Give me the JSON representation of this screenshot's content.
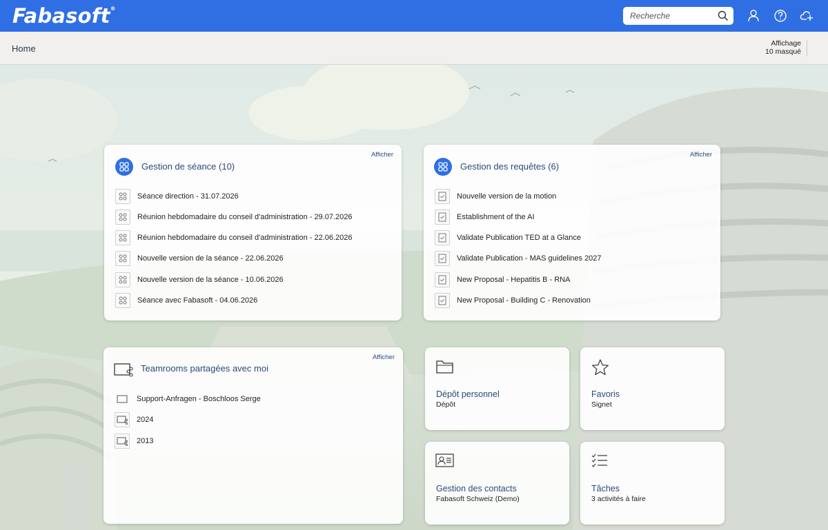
{
  "header": {
    "logo_text": "Fabasoft",
    "logo_reg": "®",
    "search_placeholder": "Recherche"
  },
  "navbar": {
    "breadcrumb": "Home",
    "display_label": "Affichage",
    "hidden_count": "10 masqué"
  },
  "meetings": {
    "title": "Gestion de séance (10)",
    "action": "Afficher",
    "items": [
      {
        "label": "Séance direction - 31.07.2026"
      },
      {
        "label": "Réunion hebdomadaire du conseil d'administration - 29.07.2026"
      },
      {
        "label": "Réunion hebdomadaire du conseil d'administration - 22.06.2026"
      },
      {
        "label": "Nouvelle version de la séance - 22.06.2026"
      },
      {
        "label": "Nouvelle version de la séance - 10.06.2026"
      },
      {
        "label": "Séance avec Fabasoft - 04.06.2026"
      }
    ]
  },
  "requests": {
    "title": "Gestion des requêtes (6)",
    "action": "Afficher",
    "items": [
      {
        "label": "Nouvelle version de la motion"
      },
      {
        "label": "Establishment of the AI"
      },
      {
        "label": "Validate Publication TED at a Glance"
      },
      {
        "label": "Validate Publication - MAS guidelines 2027"
      },
      {
        "label": "New Proposal - Hepatitis B - RNA"
      },
      {
        "label": "New Proposal - Building C - Renovation"
      }
    ]
  },
  "teamrooms": {
    "title": "Teamrooms partagées avec moi",
    "action": "Afficher",
    "items": [
      {
        "label": "Support-Anfragen - Boschloos Serge"
      },
      {
        "label": "2024"
      },
      {
        "label": "2013"
      }
    ]
  },
  "tiles": {
    "personal": {
      "title": "Dépôt personnel",
      "sub": "Dépôt",
      "icon": "folder-icon"
    },
    "favorites": {
      "title": "Favoris",
      "sub": "Signet",
      "icon": "star-icon"
    },
    "contacts": {
      "title": "Gestion des contacts",
      "sub": "Fabasoft Schweiz (Demo)",
      "icon": "contact-card-icon"
    },
    "tasks": {
      "title": "Tâches",
      "sub": "3 activités à faire",
      "icon": "checklist-icon"
    }
  },
  "colors": {
    "brand": "#2f6fe3",
    "link": "#2b4a7a"
  }
}
